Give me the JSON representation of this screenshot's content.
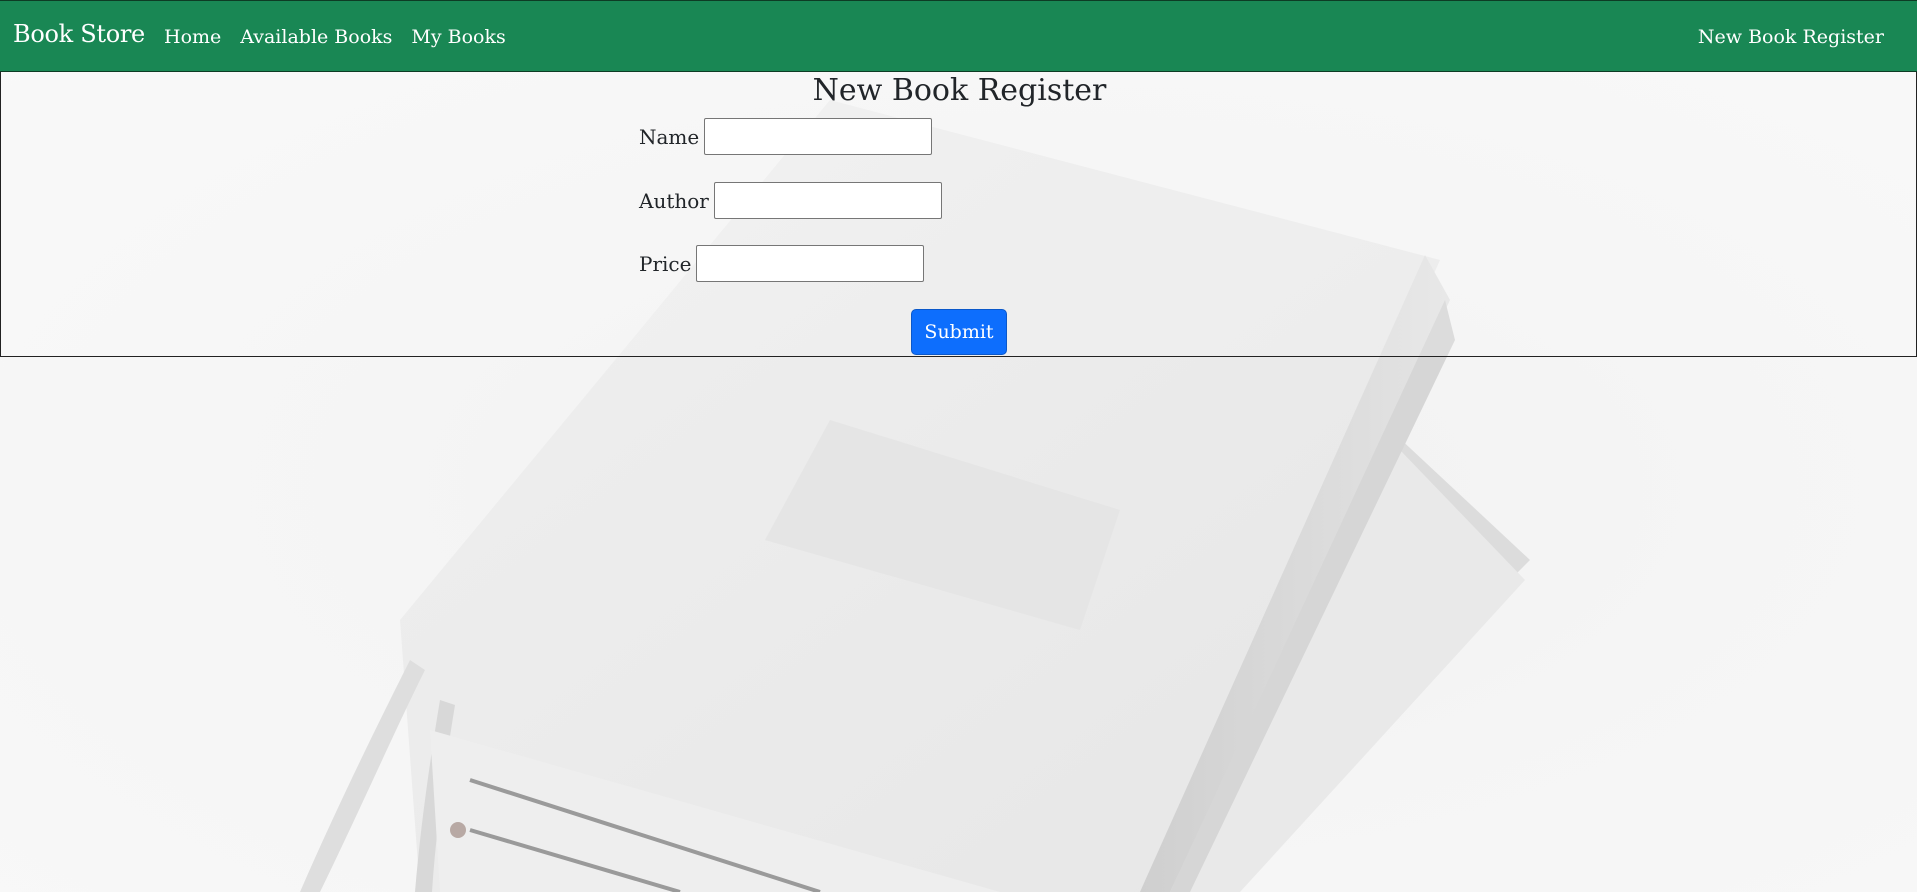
{
  "navbar": {
    "brand": "Book Store",
    "links": [
      {
        "label": "Home"
      },
      {
        "label": "Available Books"
      },
      {
        "label": "My Books"
      }
    ],
    "right_link": "New Book Register",
    "color": "#198754"
  },
  "form": {
    "title": "New Book Register",
    "fields": [
      {
        "label": "Name",
        "value": ""
      },
      {
        "label": "Author",
        "value": ""
      },
      {
        "label": "Price",
        "value": ""
      }
    ],
    "submit_label": "Submit",
    "submit_color": "#0d6efd"
  },
  "background": {
    "description_icon": "book-photo"
  }
}
